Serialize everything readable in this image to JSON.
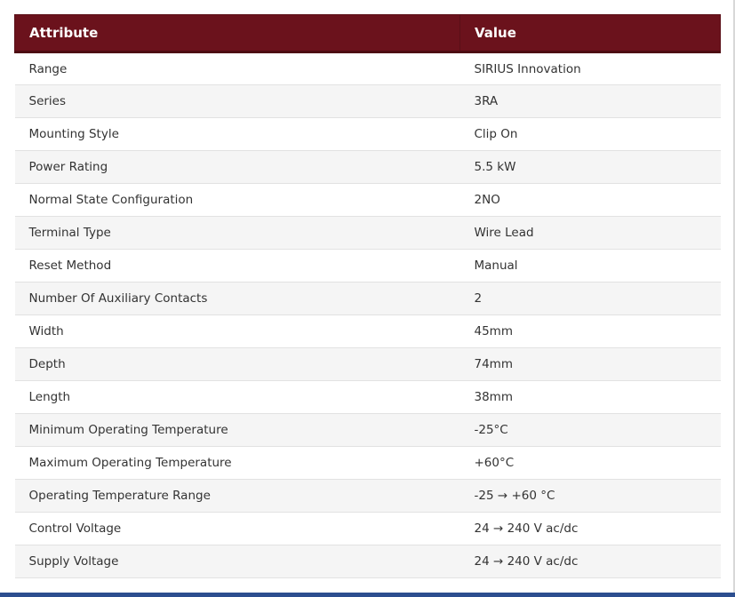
{
  "table": {
    "headers": {
      "attribute": "Attribute",
      "value": "Value"
    },
    "rows": [
      {
        "attribute": "Range",
        "value": "SIRIUS Innovation"
      },
      {
        "attribute": "Series",
        "value": "3RA"
      },
      {
        "attribute": "Mounting Style",
        "value": "Clip On"
      },
      {
        "attribute": "Power Rating",
        "value": "5.5 kW"
      },
      {
        "attribute": "Normal State Configuration",
        "value": "2NO"
      },
      {
        "attribute": "Terminal Type",
        "value": "Wire Lead"
      },
      {
        "attribute": "Reset Method",
        "value": "Manual"
      },
      {
        "attribute": "Number Of Auxiliary Contacts",
        "value": "2"
      },
      {
        "attribute": "Width",
        "value": "45mm"
      },
      {
        "attribute": "Depth",
        "value": "74mm"
      },
      {
        "attribute": "Length",
        "value": "38mm"
      },
      {
        "attribute": "Minimum Operating Temperature",
        "value": "-25°C"
      },
      {
        "attribute": "Maximum Operating Temperature",
        "value": "+60°C"
      },
      {
        "attribute": "Operating Temperature Range",
        "value": "-25 → +60 °C"
      },
      {
        "attribute": "Control Voltage",
        "value": "24 → 240 V ac/dc"
      },
      {
        "attribute": "Supply Voltage",
        "value": "24 → 240 V ac/dc"
      }
    ]
  },
  "colors": {
    "header_background": "#6b121c",
    "header_text": "#ffffff",
    "row_alt_background": "#f5f5f5",
    "bottom_bar": "#2c4e8f"
  }
}
